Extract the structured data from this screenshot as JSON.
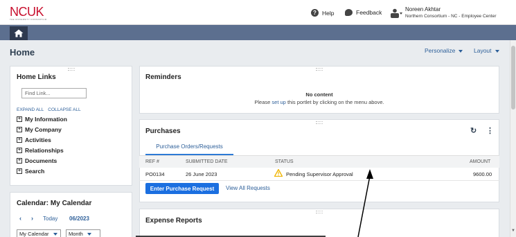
{
  "header": {
    "logo_text": "NCUK",
    "logo_subtext": "THE UNIVERSITY CONSORTIUM",
    "help_label": "Help",
    "feedback_label": "Feedback",
    "user_name": "Noreen Akhtar",
    "user_org": "Northern Consortium - NC - Employee Center"
  },
  "page": {
    "title": "Home",
    "personalize_label": "Personalize",
    "layout_label": "Layout"
  },
  "home_links": {
    "title": "Home Links",
    "find_placeholder": "Find Link...",
    "expand_all": "EXPAND ALL",
    "collapse_all": "COLLAPSE ALL",
    "items": [
      {
        "label": "My Information"
      },
      {
        "label": "My Company"
      },
      {
        "label": "Activities"
      },
      {
        "label": "Relationships"
      },
      {
        "label": "Documents"
      },
      {
        "label": "Search"
      }
    ]
  },
  "calendar": {
    "title": "Calendar: My Calendar",
    "today_label": "Today",
    "period": "06/2023",
    "calendar_select": "My Calendar",
    "view_select": "Month"
  },
  "reminders": {
    "title": "Reminders",
    "no_content": "No content",
    "hint_prefix": "Please ",
    "hint_link": "set up",
    "hint_suffix": " this portlet by clicking on the menu above."
  },
  "purchases": {
    "title": "Purchases",
    "tab_label": "Purchase Orders/Requests",
    "columns": [
      "REF #",
      "SUBMITTED DATE",
      "STATUS",
      "AMOUNT"
    ],
    "rows": [
      {
        "ref": "PO0134",
        "date": "26 June 2023",
        "status": "Pending Supervisor Approval",
        "amount": "9600.00"
      }
    ],
    "enter_button": "Enter Purchase Request",
    "view_all": "View All Requests"
  },
  "expense_reports": {
    "title": "Expense Reports"
  },
  "icons": {
    "home": "home-icon",
    "help": "question-circle-icon",
    "feedback": "chat-bubble-icon",
    "user": "user-menu-icon",
    "warning": "warning-triangle-icon",
    "refresh": "refresh-icon",
    "more": "kebab-menu-icon"
  },
  "colors": {
    "brand_red": "#c8102e",
    "nav_bar": "#5c6f8f",
    "link_blue": "#2d5f99",
    "primary_button": "#1b6fe0",
    "warning": "#f0b400"
  }
}
